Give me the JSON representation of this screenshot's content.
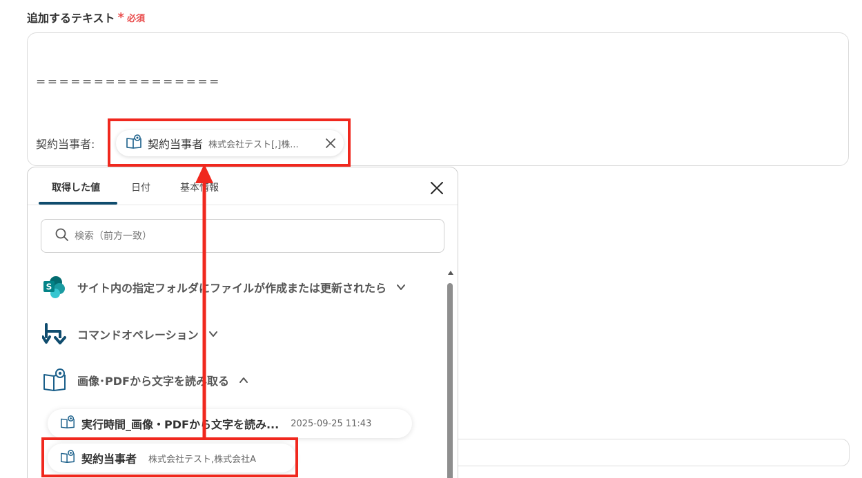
{
  "field": {
    "label": "追加するテキスト",
    "required_mark": "*",
    "required_text": "必須"
  },
  "editor": {
    "separator_line": "================",
    "party_label": "契約当事者:"
  },
  "token": {
    "name": "契約当事者",
    "value": "株式会社テスト[,]株..."
  },
  "panel": {
    "tabs": [
      {
        "label": "取得した値",
        "active": true
      },
      {
        "label": "日付",
        "active": false
      },
      {
        "label": "基本情報",
        "active": false
      }
    ],
    "search": {
      "placeholder": "検索（前方一致）",
      "value": ""
    },
    "sections": [
      {
        "title": "サイト内の指定フォルダにファイルが作成または更新されたら",
        "icon": "sharepoint-icon",
        "expanded": false
      },
      {
        "title": "コマンドオペレーション",
        "icon": "command-operation-icon",
        "expanded": false
      },
      {
        "title": "画像･PDFから文字を読み取る",
        "icon": "ocr-book-icon",
        "expanded": true
      }
    ],
    "items": [
      {
        "name": "実行時間_画像・PDFから文字を読み...",
        "value": "2025-09-25 11:43"
      },
      {
        "name": "契約当事者",
        "value": "株式会社テスト,株式会社A"
      }
    ]
  },
  "colors": {
    "highlight": "#f0281e",
    "accent": "#0f4c6e",
    "required": "#e94c4c"
  }
}
